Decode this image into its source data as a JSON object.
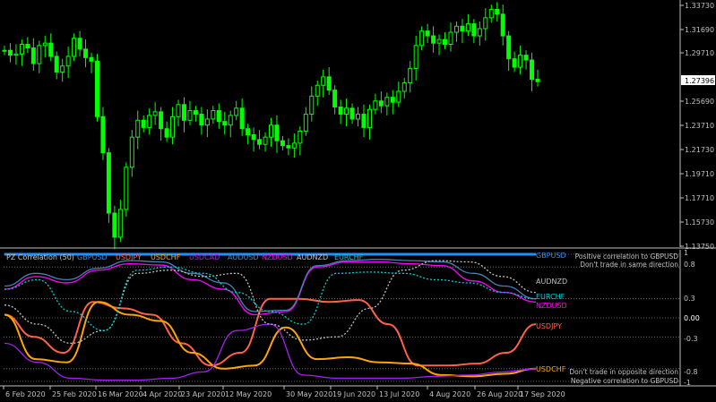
{
  "price": {
    "axis_labels": [
      "1.33730",
      "1.31690",
      "1.29710",
      "1.27396",
      "1.25690",
      "1.23710",
      "1.21730",
      "1.19710",
      "1.17710",
      "1.15730",
      "1.13750"
    ],
    "current_price": "1.27396",
    "chart_data": {
      "type": "candlestick",
      "symbol": "GBPUSD",
      "ylim": [
        1.1375,
        1.3373
      ],
      "x_dates": [
        "6 Feb 2020",
        "25 Feb 2020",
        "16 Mar 2020",
        "4 Apr 2020",
        "23 Apr 2020",
        "12 May 2020",
        "30 May 2020",
        "19 Jun 2020",
        "13 Jul 2020",
        "4 Aug 2020",
        "26 Aug 2020",
        "17 Sep 2020"
      ],
      "close_approx": [
        1.3,
        1.296,
        1.297,
        1.305,
        1.302,
        1.289,
        1.304,
        1.306,
        1.295,
        1.282,
        1.287,
        1.295,
        1.31,
        1.301,
        1.294,
        1.291,
        1.245,
        1.215,
        1.165,
        1.145,
        1.168,
        1.203,
        1.228,
        1.242,
        1.236,
        1.246,
        1.249,
        1.235,
        1.228,
        1.245,
        1.255,
        1.242,
        1.25,
        1.247,
        1.238,
        1.243,
        1.25,
        1.241,
        1.238,
        1.246,
        1.252,
        1.235,
        1.23,
        1.226,
        1.222,
        1.228,
        1.238,
        1.225,
        1.221,
        1.219,
        1.223,
        1.233,
        1.247,
        1.262,
        1.271,
        1.278,
        1.267,
        1.253,
        1.247,
        1.252,
        1.243,
        1.247,
        1.236,
        1.251,
        1.258,
        1.254,
        1.261,
        1.257,
        1.266,
        1.273,
        1.285,
        1.304,
        1.316,
        1.312,
        1.306,
        1.309,
        1.305,
        1.315,
        1.32,
        1.316,
        1.322,
        1.312,
        1.318,
        1.327,
        1.334,
        1.33,
        1.312,
        1.293,
        1.286,
        1.296,
        1.292,
        1.276,
        1.274
      ]
    }
  },
  "indicator": {
    "title": "PZ Correlation (50)",
    "legend": [
      {
        "name": "GBPUSD",
        "color": "#1e90ff"
      },
      {
        "name": "USDJPY",
        "color": "#ff6347"
      },
      {
        "name": "USDCHF",
        "color": "#ffa500"
      },
      {
        "name": "USDCAD",
        "color": "#a020f0"
      },
      {
        "name": "AUDUSD",
        "color": "#4682b4"
      },
      {
        "name": "NZDUSD",
        "color": "#ff00ff"
      },
      {
        "name": "AUDNZD",
        "color": "#c0c0c0"
      },
      {
        "name": "EURCHF",
        "color": "#00ced1"
      }
    ],
    "level_labels": {
      "l1": "1",
      "l08": "0.8",
      "l03": "0.3",
      "l00": "0.00",
      "lm03": "-0.3",
      "lm08": "-0.8",
      "lm1": "-1"
    },
    "right_texts": {
      "pos_corr": "Positive correlation to GBPUSD",
      "same_dir": "Don't trade in same direction",
      "opp_dir": "Don't trade in opposite direction",
      "neg_corr": "Negative correlation to GBPUSD"
    },
    "end_labels": {
      "gbpusd": "GBPUSD",
      "audnzd": "AUDNZD",
      "eurchf": "EURCHF",
      "nzdusd": "NZDUSD",
      "usdjpy": "USDJPY",
      "usdchf": "USDCHF"
    },
    "chart_data": {
      "type": "line",
      "ylim": [
        -1,
        1
      ],
      "x_dates": [
        "6 Feb 2020",
        "25 Feb 2020",
        "16 Mar 2020",
        "4 Apr 2020",
        "23 Apr 2020",
        "12 May 2020",
        "30 May 2020",
        "19 Jun 2020",
        "13 Jul 2020",
        "4 Aug 2020",
        "26 Aug 2020",
        "17 Sep 2020"
      ],
      "levels": [
        1,
        0.8,
        0.3,
        0.0,
        -0.3,
        -0.8,
        -1
      ],
      "series": [
        {
          "name": "GBPUSD",
          "color": "#1e90ff",
          "style": "solid",
          "values": [
            1,
            1,
            1,
            1,
            1,
            1,
            1,
            1,
            1,
            1,
            1,
            1,
            1
          ]
        },
        {
          "name": "USDJPY",
          "color": "#ff6347",
          "style": "solid",
          "values": [
            0.05,
            -0.3,
            -0.55,
            0.25,
            0.15,
            0.05,
            -0.4,
            -0.75,
            -0.55,
            0.3,
            0.3,
            0.25,
            0.28,
            -0.1,
            -0.75,
            -0.75,
            -0.72,
            -0.55,
            -0.1
          ]
        },
        {
          "name": "USDCHF",
          "color": "#ffa500",
          "style": "solid",
          "values": [
            0.05,
            -0.65,
            -0.7,
            0.25,
            0.05,
            -0.05,
            -0.55,
            -0.8,
            -0.75,
            -0.15,
            -0.65,
            -0.62,
            -0.7,
            -0.72,
            -0.9,
            -0.92,
            -0.88,
            -0.8
          ]
        },
        {
          "name": "NZDUSD",
          "color": "#ff00ff",
          "style": "solid",
          "values": [
            0.45,
            0.65,
            0.55,
            0.75,
            0.85,
            0.83,
            0.6,
            0.45,
            0.05,
            0.1,
            0.8,
            0.88,
            0.88,
            0.85,
            0.82,
            0.58,
            0.4,
            0.25
          ]
        },
        {
          "name": "AUDUSD",
          "color": "#4682b4",
          "style": "solid",
          "values": [
            0.5,
            0.7,
            0.6,
            0.78,
            0.9,
            0.88,
            0.7,
            0.55,
            0.1,
            0.12,
            0.82,
            0.9,
            0.92,
            0.9,
            0.88,
            0.7,
            0.5,
            0.3
          ]
        },
        {
          "name": "USDCAD",
          "color": "#a020f0",
          "style": "solid",
          "values": [
            -0.4,
            -0.7,
            -0.95,
            -0.98,
            -0.98,
            -0.95,
            -0.85,
            -0.2,
            -0.1,
            -0.9,
            -0.95,
            -0.95,
            -0.95,
            -0.92,
            -0.9,
            -0.85,
            -0.8
          ]
        },
        {
          "name": "AUDNZD",
          "color": "#c0c0c0",
          "style": "dashed",
          "values": [
            0.2,
            -0.1,
            -0.4,
            -0.2,
            0.7,
            0.75,
            0.65,
            0.7,
            -0.1,
            -0.35,
            -0.3,
            0.15,
            0.75,
            0.9,
            0.88,
            0.65,
            0.4
          ]
        },
        {
          "name": "EURCHF",
          "color": "#00ced1",
          "style": "dashed",
          "values": [
            0.45,
            0.6,
            0.1,
            -0.2,
            0.75,
            0.8,
            0.7,
            0.4,
            0.1,
            -0.1,
            0.7,
            0.72,
            0.7,
            0.6,
            0.55,
            0.4,
            0.3
          ]
        }
      ]
    }
  },
  "time_axis": [
    "6 Feb 2020",
    "25 Feb 2020",
    "16 Mar 2020",
    "4 Apr 2020",
    "23 Apr 2020",
    "12 May 2020",
    "30 May 2020",
    "19 Jun 2020",
    "13 Jul 2020",
    "4 Aug 2020",
    "26 Aug 2020",
    "17 Sep 2020"
  ]
}
